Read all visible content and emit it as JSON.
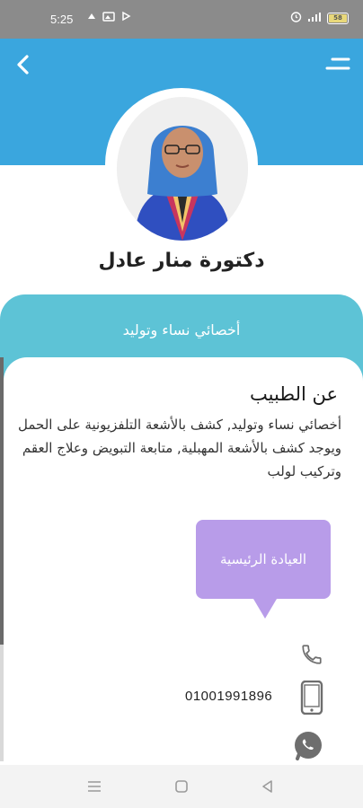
{
  "status_bar": {
    "time": "5:25",
    "left_icons": [
      "notification-icon",
      "gallery-icon",
      "play-icon"
    ],
    "right_icons": [
      "alarm-icon",
      "signal-icon",
      "battery-icon"
    ],
    "battery_level": "58"
  },
  "header": {
    "back_icon": "chevron-left-icon",
    "menu_icon": "menu-icon",
    "background_color": "#3aa6de"
  },
  "doctor": {
    "name": "دكتورة منار عادل",
    "specialty": "أخصائي نساء وتوليد"
  },
  "about": {
    "title": "عن الطبيب",
    "text": "أخصائي نساء وتوليد, كشف بالأشعة التلفزيونية على الحمل ويوجد كشف بالأشعة المهبلية, متابعة التبويض وعلاج العقم وتركيب لولب"
  },
  "clinic": {
    "label": "العيادة الرئيسية",
    "color": "#b89ce9"
  },
  "contacts": {
    "phone_number": "01001991896",
    "icons": [
      "phone-icon",
      "mobile-icon",
      "whatsapp-icon"
    ]
  },
  "navigation": {
    "buttons": [
      "recent-apps-icon",
      "home-icon",
      "back-triangle-icon"
    ]
  }
}
